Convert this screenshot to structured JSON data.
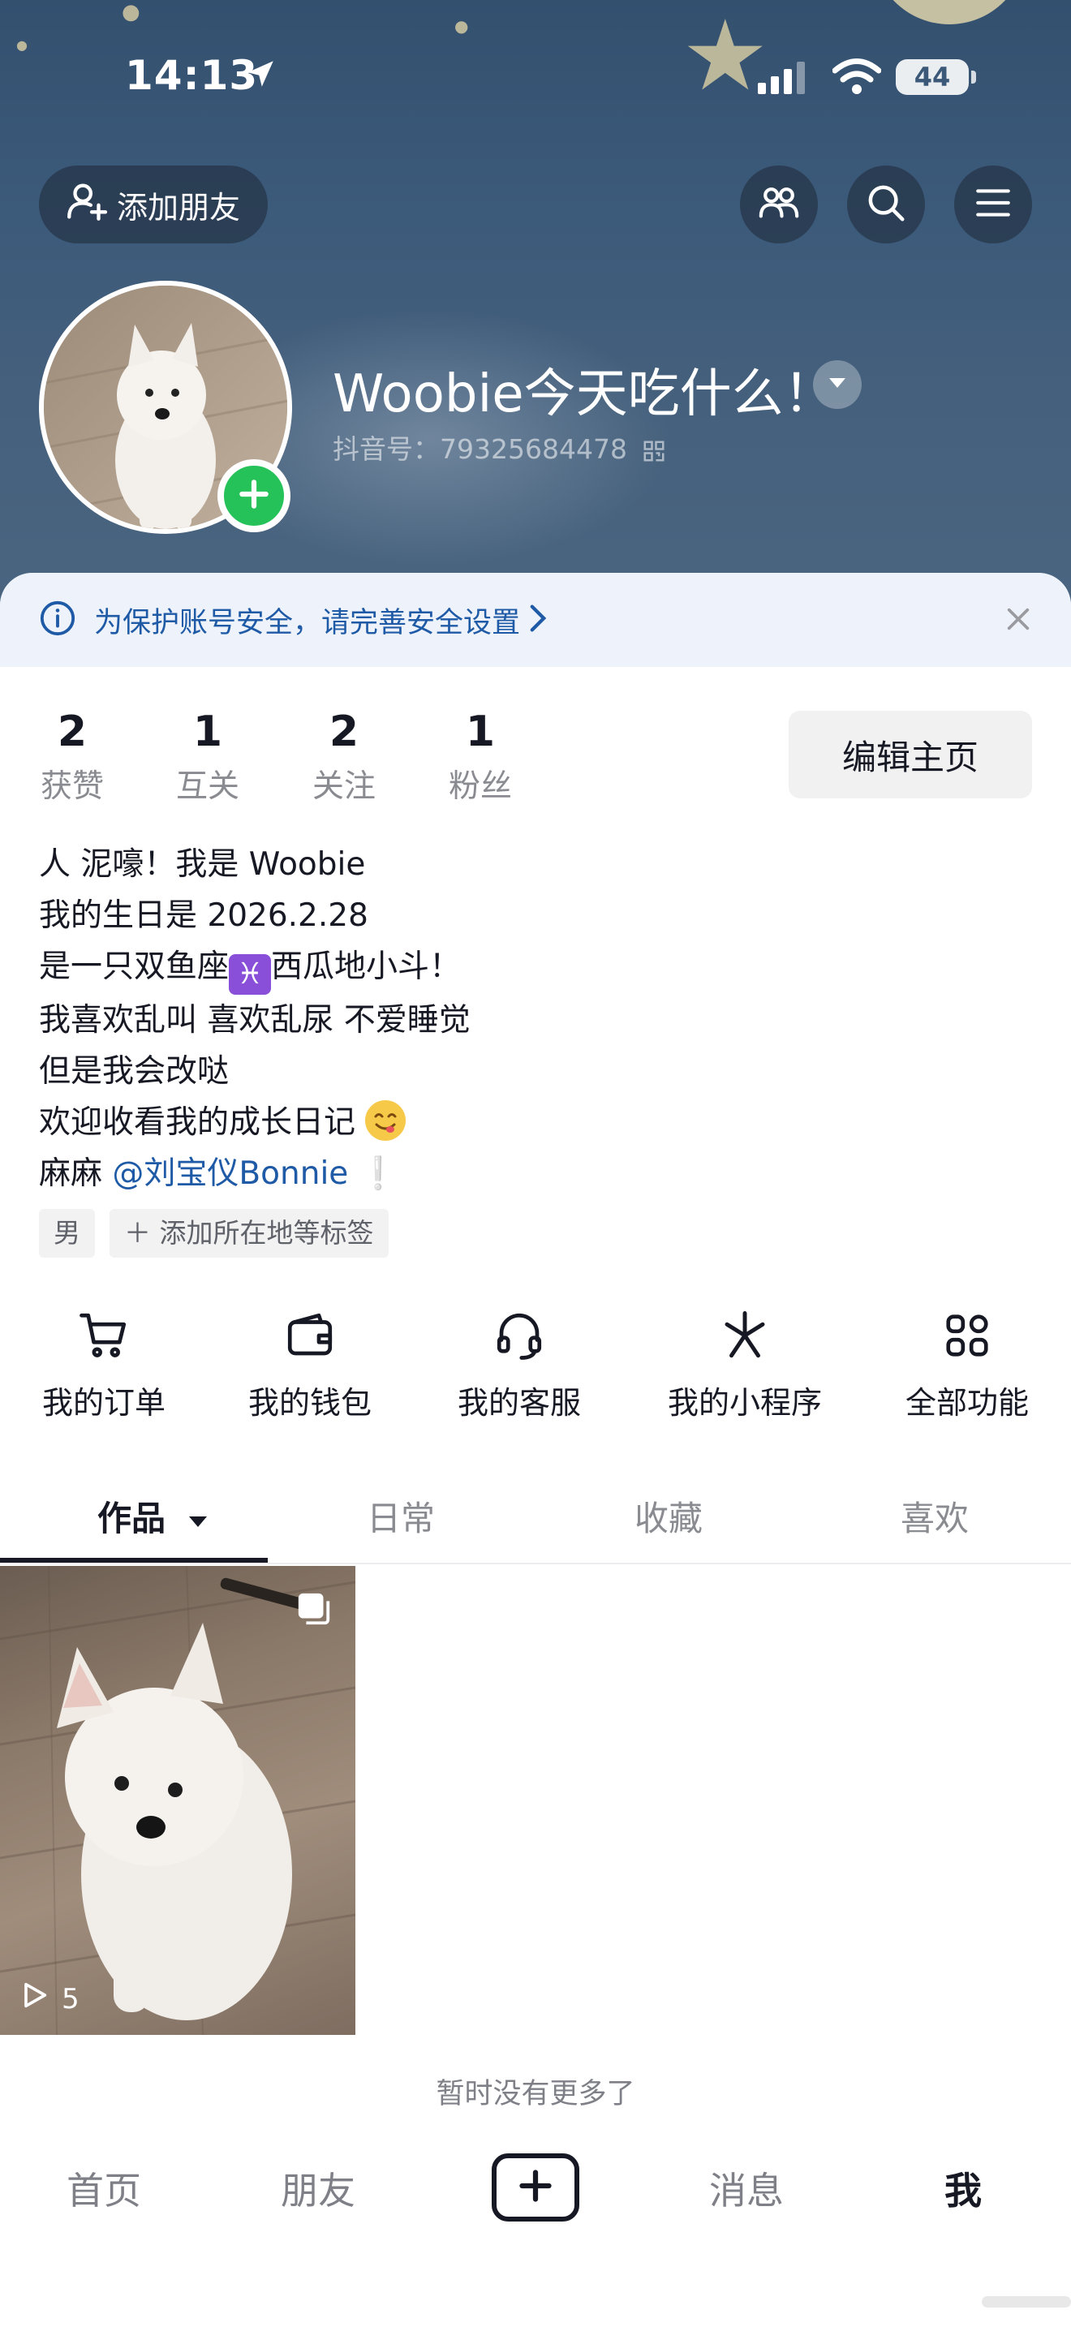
{
  "status_bar": {
    "time": "14:13",
    "battery": "44"
  },
  "header": {
    "add_friend_label": "添加朋友",
    "nickname": "Woobie今天吃什么！",
    "douyin_id": "抖音号：79325684478"
  },
  "notice": {
    "text": "为保护账号安全，请完善安全设置"
  },
  "stats": [
    {
      "value": "2",
      "label": "获赞"
    },
    {
      "value": "1",
      "label": "互关"
    },
    {
      "value": "2",
      "label": "关注"
    },
    {
      "value": "1",
      "label": "粉丝"
    }
  ],
  "edit_profile_label": "编辑主页",
  "bio": {
    "line1": "人 泥嚎！我是 Woobie",
    "line2": "我的生日是 2026.2.28",
    "line3_before": "是一只双鱼座",
    "line3_after": "西瓜地小斗！",
    "line4": "我喜欢乱叫 喜欢乱尿 不爱睡觉",
    "line5": "但是我会改哒",
    "line6": "欢迎收看我的成长日记",
    "line7_prefix": "麻麻",
    "line7_mention": "@刘宝仪Bonnie",
    "line7_suffix": "❕"
  },
  "tags": {
    "gender": "男",
    "add_location": "＋ 添加所在地等标签"
  },
  "functions": [
    {
      "label": "我的订单",
      "icon": "cart-icon"
    },
    {
      "label": "我的钱包",
      "icon": "wallet-icon"
    },
    {
      "label": "我的客服",
      "icon": "headset-icon"
    },
    {
      "label": "我的小程序",
      "icon": "asterisk-icon"
    },
    {
      "label": "全部功能",
      "icon": "grid-icon"
    }
  ],
  "tabs": [
    {
      "label": "作品",
      "active": true
    },
    {
      "label": "日常"
    },
    {
      "label": "收藏"
    },
    {
      "label": "喜欢"
    }
  ],
  "videos": [
    {
      "plays": "5"
    }
  ],
  "no_more_text": "暂时没有更多了",
  "bottom_nav": {
    "home": "首页",
    "friends": "朋友",
    "messages": "消息",
    "me": "我"
  },
  "colors": {
    "header_bg": "#3c5a7a",
    "accent_green": "#25c25a",
    "link_blue": "#1f5aa6",
    "notice_bg": "#eef3fb"
  }
}
